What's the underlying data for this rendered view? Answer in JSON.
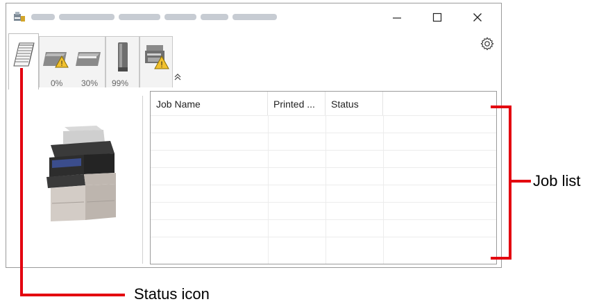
{
  "window": {
    "title_obscured": true
  },
  "tabs": [
    {
      "id": "job-queue",
      "icon": "stacked-pages-icon",
      "label": ""
    },
    {
      "id": "paper",
      "icon": "paper-tray-warning-icon",
      "levels": [
        "0%",
        "30%"
      ]
    },
    {
      "id": "toner",
      "icon": "toner-cartridge-icon",
      "levels": [
        "99%"
      ]
    },
    {
      "id": "device",
      "icon": "printer-warning-icon",
      "label": ""
    }
  ],
  "job_list": {
    "columns": [
      "Job Name",
      "Printed ...",
      "Status",
      ""
    ],
    "rows": [],
    "empty_row_count": 8
  },
  "annotations": {
    "job_list_label": "Job list",
    "status_icon_label": "Status icon",
    "color": "#e3000f"
  }
}
